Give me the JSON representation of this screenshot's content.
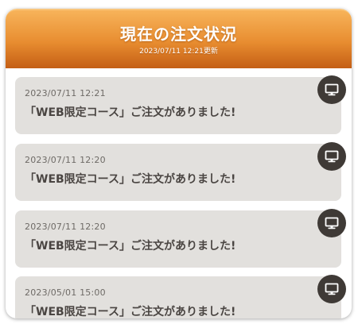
{
  "header": {
    "title": "現在の注文状況",
    "updated": "2023/07/11 12:21更新"
  },
  "orders": [
    {
      "time": "2023/07/11 12:21",
      "message": "「WEB限定コース」ご注文がありました!",
      "device_icon": "desktop-monitor-icon"
    },
    {
      "time": "2023/07/11 12:20",
      "message": "「WEB限定コース」ご注文がありました!",
      "device_icon": "desktop-monitor-icon"
    },
    {
      "time": "2023/07/11 12:20",
      "message": "「WEB限定コース」ご注文がありました!",
      "device_icon": "desktop-monitor-icon"
    },
    {
      "time": "2023/05/01 15:00",
      "message": "「WEB限定コース」ご注文がありました!",
      "device_icon": "desktop-monitor-icon"
    }
  ],
  "colors": {
    "header_top": "#f7b35a",
    "header_bottom": "#c45e15",
    "card_bg": "#e2e0dd",
    "badge_bg": "#3f3a36",
    "message_text": "#4a4542"
  }
}
